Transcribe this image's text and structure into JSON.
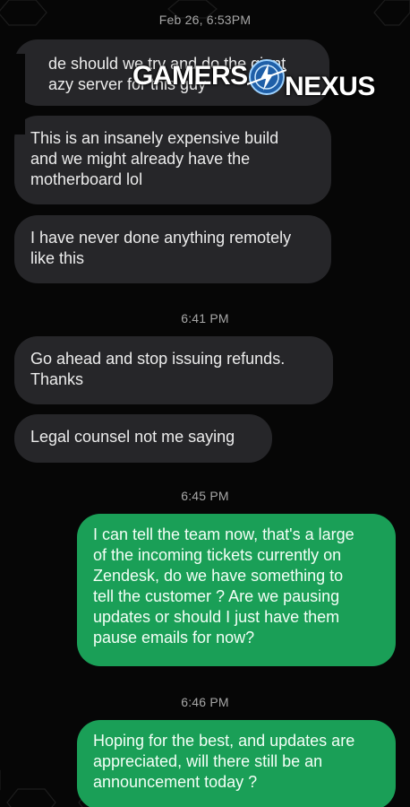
{
  "brand": {
    "logo_left": "GAMERS",
    "logo_right": "NEXUS",
    "logo_color": "#ffffff",
    "logo_accent": "#2b8fd8"
  },
  "colors": {
    "background": "#060606",
    "incoming_bubble": "#262629",
    "outgoing_bubble": "#1a9f57",
    "timestamp_text": "#a7a7a7"
  },
  "thread": {
    "timestamps": [
      "Feb 26, 6:53PM",
      "6:41 PM",
      "6:45 PM",
      "6:46 PM"
    ],
    "messages": [
      {
        "direction": "incoming",
        "text": "de should we try and do the giant\nazy server for this guy"
      },
      {
        "direction": "incoming",
        "text": "This is an insanely expensive build\nand we might already have the\nmotherboard lol"
      },
      {
        "direction": "incoming",
        "text": "I have never done anything remotely\nlike this"
      },
      {
        "direction": "incoming",
        "text": "Go ahead and stop issuing refunds.\nThanks"
      },
      {
        "direction": "incoming",
        "text": "Legal counsel not me saying"
      },
      {
        "direction": "outgoing",
        "text": "I can tell the team now, that's a large\nof the incoming tickets currently on\nZendesk, do we have something to\ntell the customer ? Are we pausing\nupdates or should I just have them\npause emails for now?"
      },
      {
        "direction": "outgoing",
        "text": "Hoping for the best, and updates are\nappreciated, will there still be an\nannouncement today ?"
      }
    ]
  }
}
